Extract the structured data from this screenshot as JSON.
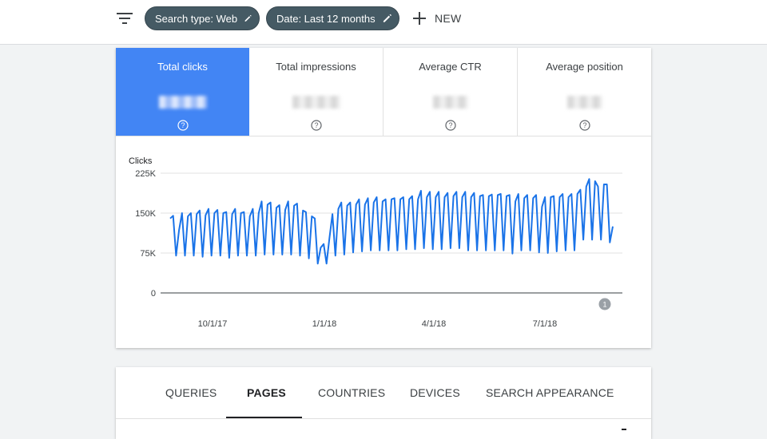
{
  "toolbar": {
    "filter_icon": "filter-list-icon",
    "chips": [
      {
        "label": "Search type: Web",
        "icon": "pencil-icon"
      },
      {
        "label": "Date: Last 12 months",
        "icon": "pencil-icon"
      }
    ],
    "new_label": "NEW",
    "new_icon": "plus-icon"
  },
  "metrics": [
    {
      "label": "Total clicks",
      "active": true
    },
    {
      "label": "Total impressions",
      "active": false
    },
    {
      "label": "Average CTR",
      "active": false
    },
    {
      "label": "Average position",
      "active": false
    }
  ],
  "colors": {
    "accent": "#4285f4",
    "line": "#1a73e8",
    "chip": "#455a64"
  },
  "chart_data": {
    "type": "line",
    "ylabel": "Clicks",
    "ylim": [
      0,
      225000
    ],
    "yticks": [
      "0",
      "75K",
      "150K",
      "225K"
    ],
    "yticks_values": [
      0,
      75000,
      150000,
      225000
    ],
    "xticks": [
      "10/1/17",
      "1/1/18",
      "4/1/18",
      "7/1/18"
    ],
    "grid": true,
    "annotation": "1",
    "series": [
      {
        "values": [
          140000,
          145000,
          70000,
          118000,
          150000,
          70000,
          144000,
          150000,
          70000,
          148000,
          155000,
          68000,
          146000,
          158000,
          70000,
          150000,
          156000,
          70000,
          150000,
          152000,
          66000,
          148000,
          158000,
          70000,
          150000,
          152000,
          70000,
          144000,
          158000,
          70000,
          150000,
          172000,
          72000,
          166000,
          170000,
          72000,
          160000,
          165000,
          72000,
          156000,
          172000,
          72000,
          164000,
          168000,
          70000,
          155000,
          152000,
          65000,
          144000,
          140000,
          55000,
          85000,
          92000,
          55000,
          104000,
          148000,
          70000,
          158000,
          170000,
          72000,
          164000,
          170000,
          76000,
          166000,
          176000,
          78000,
          166000,
          178000,
          80000,
          170000,
          180000,
          80000,
          172000,
          176000,
          80000,
          176000,
          178000,
          80000,
          176000,
          180000,
          82000,
          176000,
          182000,
          82000,
          176000,
          192000,
          84000,
          180000,
          190000,
          82000,
          180000,
          190000,
          82000,
          180000,
          188000,
          84000,
          182000,
          190000,
          84000,
          180000,
          190000,
          80000,
          180000,
          188000,
          80000,
          182000,
          184000,
          80000,
          182000,
          185000,
          80000,
          184000,
          186000,
          80000,
          182000,
          184000,
          74000,
          172000,
          186000,
          80000,
          178000,
          184000,
          80000,
          178000,
          184000,
          76000,
          162000,
          180000,
          75000,
          180000,
          182000,
          78000,
          180000,
          186000,
          80000,
          180000,
          186000,
          80000,
          186000,
          194000,
          100000,
          200000,
          214000,
          100000,
          210000,
          200000,
          100000,
          204000,
          204000,
          95000,
          125000
        ]
      }
    ]
  },
  "tabs": [
    {
      "label": "QUERIES",
      "active": false
    },
    {
      "label": "PAGES",
      "active": true
    },
    {
      "label": "COUNTRIES",
      "active": false
    },
    {
      "label": "DEVICES",
      "active": false
    },
    {
      "label": "SEARCH APPEARANCE",
      "active": false
    }
  ]
}
